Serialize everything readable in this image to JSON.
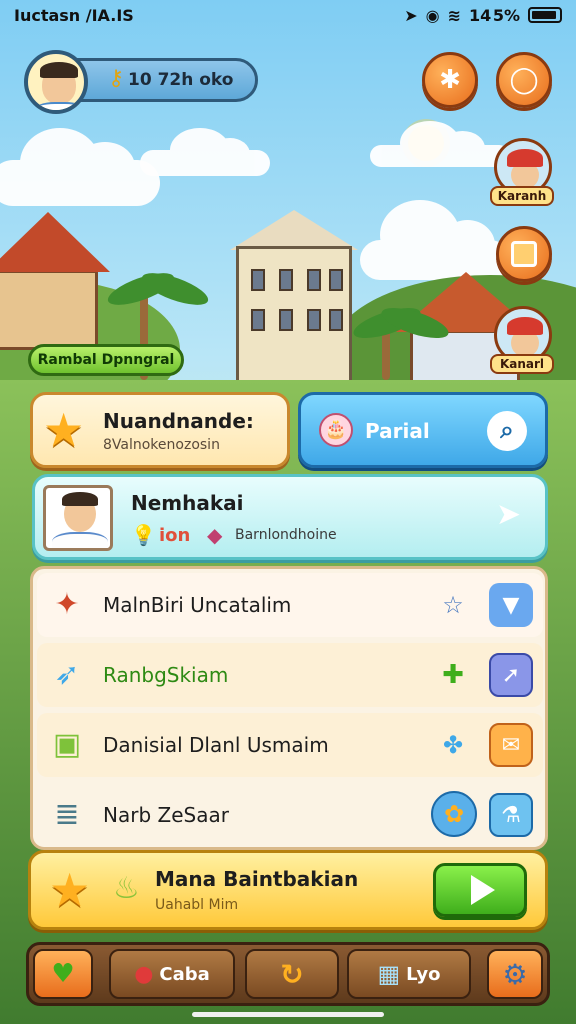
{
  "status_bar": {
    "left_text": "Iuctasn ∕IA.IS",
    "battery_text": "14 5%"
  },
  "hud": {
    "currency_text": "10 72h oko",
    "top_button_1_icon": "puzzle-icon",
    "top_button_2_icon": "settings-ring-icon"
  },
  "npcs": {
    "npc_1_label": "Karanh",
    "npc_2_label": "Kanarl"
  },
  "location": {
    "tag": "Rambal Dpnngral"
  },
  "quest_card": {
    "title": "Nuandnande:",
    "subtitle": "8Valnokenozosin"
  },
  "search_card": {
    "label": "Parial"
  },
  "profile_card": {
    "name": "Nemhakai",
    "stat_value": "ion",
    "stat_label": "Barnlondhoine"
  },
  "list": {
    "rows": [
      {
        "label": "MalnBiri Uncatalim"
      },
      {
        "label": "RanbgSkiam"
      },
      {
        "label": "Danisial Dlanl Usmaim"
      },
      {
        "label": "Narb ZeSaar"
      }
    ]
  },
  "bottom_card": {
    "title": "Mana Baintbakian",
    "subtitle": "Uahabl Mim"
  },
  "nav": {
    "item_2_label": "Caba",
    "item_4_label": "Lyo"
  },
  "colors": {
    "accent": "#e86d1c",
    "play": "#3fae1c",
    "search": "#3fa8e8"
  }
}
